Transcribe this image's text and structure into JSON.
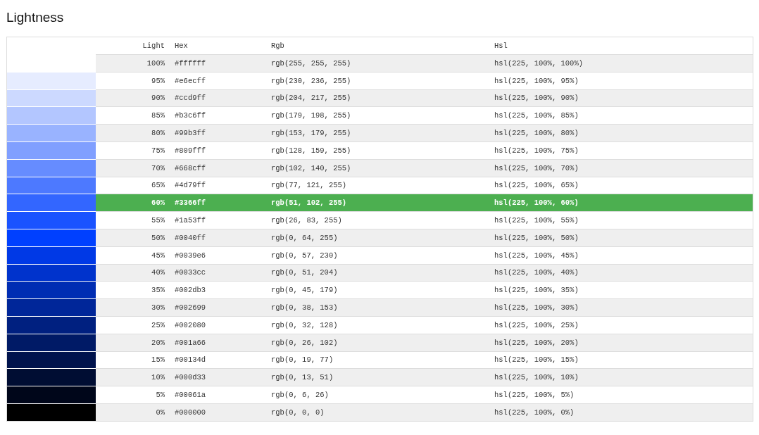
{
  "title": "Lightness",
  "table": {
    "columns": [
      "Light",
      "Hex",
      "Rgb",
      "Hsl"
    ],
    "rows": [
      {
        "light": "100%",
        "hex": "#ffffff",
        "rgb": "rgb(255, 255, 255)",
        "hsl": "hsl(225, 100%, 100%)",
        "color": "#ffffff",
        "selected": false
      },
      {
        "light": "95%",
        "hex": "#e6ecff",
        "rgb": "rgb(230, 236, 255)",
        "hsl": "hsl(225, 100%, 95%)",
        "color": "#e6ecff",
        "selected": false
      },
      {
        "light": "90%",
        "hex": "#ccd9ff",
        "rgb": "rgb(204, 217, 255)",
        "hsl": "hsl(225, 100%, 90%)",
        "color": "#ccd9ff",
        "selected": false
      },
      {
        "light": "85%",
        "hex": "#b3c6ff",
        "rgb": "rgb(179, 198, 255)",
        "hsl": "hsl(225, 100%, 85%)",
        "color": "#b3c6ff",
        "selected": false
      },
      {
        "light": "80%",
        "hex": "#99b3ff",
        "rgb": "rgb(153, 179, 255)",
        "hsl": "hsl(225, 100%, 80%)",
        "color": "#99b3ff",
        "selected": false
      },
      {
        "light": "75%",
        "hex": "#809fff",
        "rgb": "rgb(128, 159, 255)",
        "hsl": "hsl(225, 100%, 75%)",
        "color": "#809fff",
        "selected": false
      },
      {
        "light": "70%",
        "hex": "#668cff",
        "rgb": "rgb(102, 140, 255)",
        "hsl": "hsl(225, 100%, 70%)",
        "color": "#668cff",
        "selected": false
      },
      {
        "light": "65%",
        "hex": "#4d79ff",
        "rgb": "rgb(77, 121, 255)",
        "hsl": "hsl(225, 100%, 65%)",
        "color": "#4d79ff",
        "selected": false
      },
      {
        "light": "60%",
        "hex": "#3366ff",
        "rgb": "rgb(51, 102, 255)",
        "hsl": "hsl(225, 100%, 60%)",
        "color": "#3366ff",
        "selected": true
      },
      {
        "light": "55%",
        "hex": "#1a53ff",
        "rgb": "rgb(26, 83, 255)",
        "hsl": "hsl(225, 100%, 55%)",
        "color": "#1a53ff",
        "selected": false
      },
      {
        "light": "50%",
        "hex": "#0040ff",
        "rgb": "rgb(0, 64, 255)",
        "hsl": "hsl(225, 100%, 50%)",
        "color": "#0040ff",
        "selected": false
      },
      {
        "light": "45%",
        "hex": "#0039e6",
        "rgb": "rgb(0, 57, 230)",
        "hsl": "hsl(225, 100%, 45%)",
        "color": "#0039e6",
        "selected": false
      },
      {
        "light": "40%",
        "hex": "#0033cc",
        "rgb": "rgb(0, 51, 204)",
        "hsl": "hsl(225, 100%, 40%)",
        "color": "#0033cc",
        "selected": false
      },
      {
        "light": "35%",
        "hex": "#002db3",
        "rgb": "rgb(0, 45, 179)",
        "hsl": "hsl(225, 100%, 35%)",
        "color": "#002db3",
        "selected": false
      },
      {
        "light": "30%",
        "hex": "#002699",
        "rgb": "rgb(0, 38, 153)",
        "hsl": "hsl(225, 100%, 30%)",
        "color": "#002699",
        "selected": false
      },
      {
        "light": "25%",
        "hex": "#002080",
        "rgb": "rgb(0, 32, 128)",
        "hsl": "hsl(225, 100%, 25%)",
        "color": "#002080",
        "selected": false
      },
      {
        "light": "20%",
        "hex": "#001a66",
        "rgb": "rgb(0, 26, 102)",
        "hsl": "hsl(225, 100%, 20%)",
        "color": "#001a66",
        "selected": false
      },
      {
        "light": "15%",
        "hex": "#00134d",
        "rgb": "rgb(0, 19, 77)",
        "hsl": "hsl(225, 100%, 15%)",
        "color": "#00134d",
        "selected": false
      },
      {
        "light": "10%",
        "hex": "#000d33",
        "rgb": "rgb(0, 13, 51)",
        "hsl": "hsl(225, 100%, 10%)",
        "color": "#000d33",
        "selected": false
      },
      {
        "light": "5%",
        "hex": "#00061a",
        "rgb": "rgb(0, 6, 26)",
        "hsl": "hsl(225, 100%, 5%)",
        "color": "#00061a",
        "selected": false
      },
      {
        "light": "0%",
        "hex": "#000000",
        "rgb": "rgb(0, 0, 0)",
        "hsl": "hsl(225, 100%, 0%)",
        "color": "#000000",
        "selected": false
      }
    ]
  }
}
